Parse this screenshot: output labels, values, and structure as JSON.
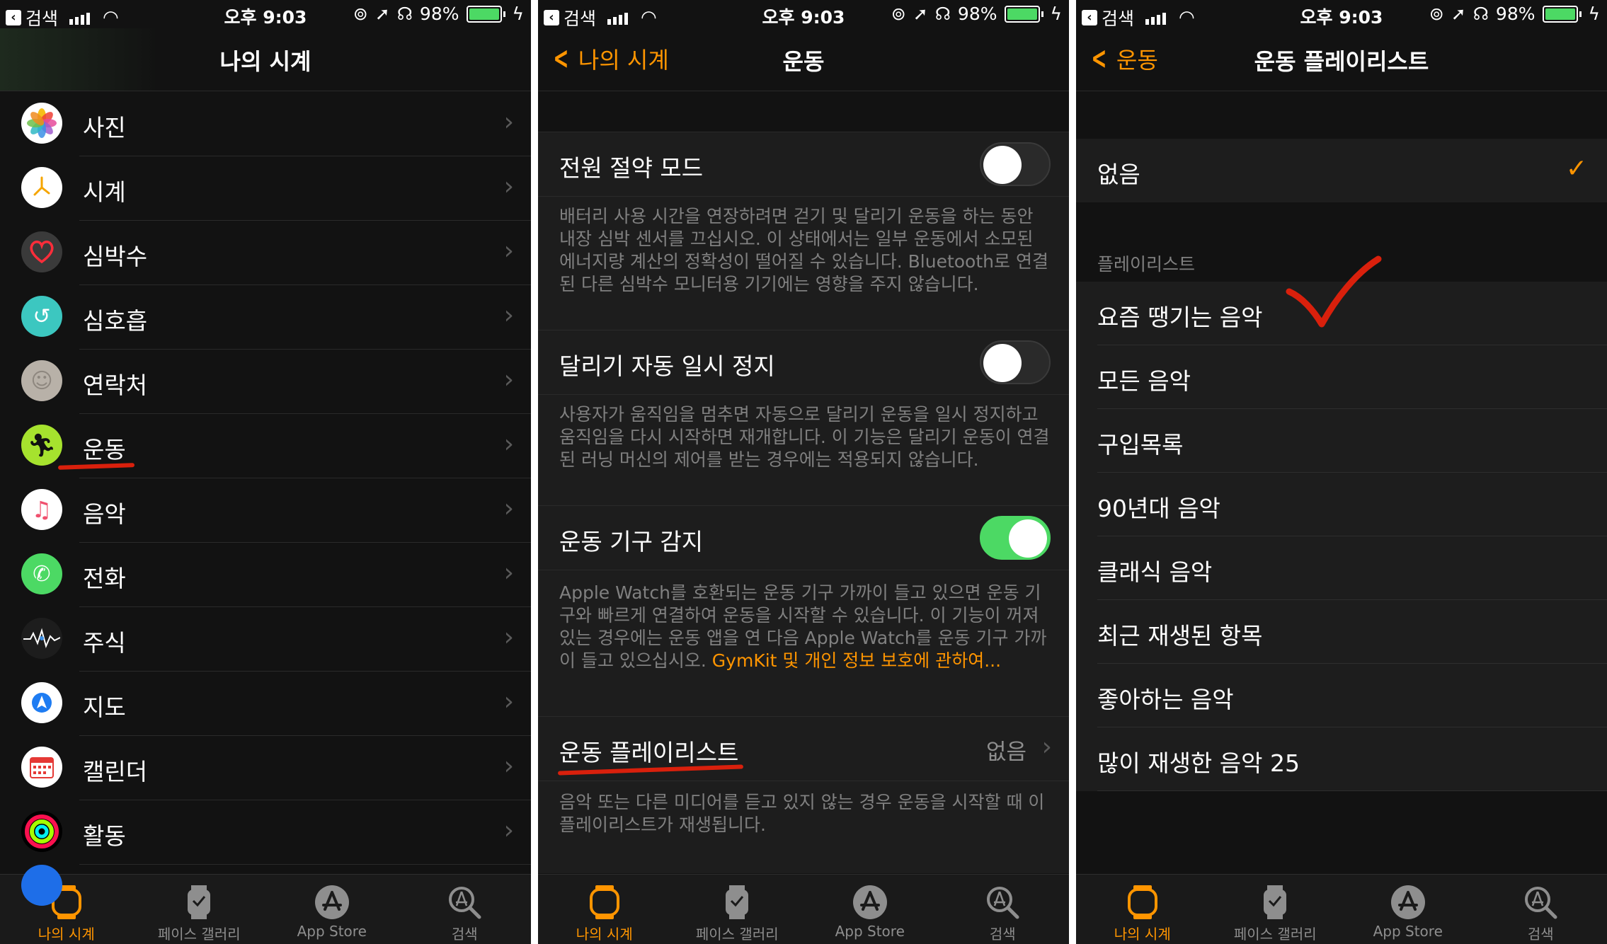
{
  "status": {
    "back_app": "검색",
    "time": "오후 9:03",
    "battery": "98%"
  },
  "colors": {
    "accent": "#ff9500",
    "toggle_on": "#4cd964",
    "annotation_red": "#d9200c"
  },
  "tabbar": {
    "items": [
      "나의 시계",
      "페이스 갤러리",
      "App Store",
      "검색"
    ]
  },
  "panel1": {
    "title": "나의 시계",
    "items": [
      {
        "label": "사진",
        "icon": "photos-icon"
      },
      {
        "label": "시계",
        "icon": "clock-icon"
      },
      {
        "label": "심박수",
        "icon": "heart-rate-icon"
      },
      {
        "label": "심호흡",
        "icon": "breathe-icon"
      },
      {
        "label": "연락처",
        "icon": "contacts-icon"
      },
      {
        "label": "운동",
        "icon": "workout-icon"
      },
      {
        "label": "음악",
        "icon": "music-icon"
      },
      {
        "label": "전화",
        "icon": "phone-icon"
      },
      {
        "label": "주식",
        "icon": "stocks-icon"
      },
      {
        "label": "지도",
        "icon": "maps-icon"
      },
      {
        "label": "캘린더",
        "icon": "calendar-icon"
      },
      {
        "label": "활동",
        "icon": "activity-icon"
      }
    ]
  },
  "panel2": {
    "back": "나의 시계",
    "title": "운동",
    "power_saving": {
      "label": "전원 절약 모드",
      "on": false
    },
    "power_saving_desc": "배터리 사용 시간을 연장하려면 걷기 및 달리기 운동을 하는 동안 내장 심박 센서를 끄십시오. 이 상태에서는 일부 운동에서 소모된 에너지량 계산의 정확성이 떨어질 수 있습니다. Bluetooth로 연결된 다른 심박수 모니터용 기기에는 영향을 주지 않습니다.",
    "auto_pause": {
      "label": "달리기 자동 일시 정지",
      "on": false
    },
    "auto_pause_desc": "사용자가 움직임을 멈추면 자동으로 달리기 운동을 일시 정지하고 움직임을 다시 시작하면 재개합니다. 이 기능은 달리기 운동이 연결된 러닝 머신의 제어를 받는 경우에는 적용되지 않습니다.",
    "equipment": {
      "label": "운동 기구 감지",
      "on": true
    },
    "equipment_desc": "Apple Watch를 호환되는 운동 기구 가까이 들고 있으면 운동 기구와 빠르게 연결하여 운동을 시작할 수 있습니다. 이 기능이 꺼져 있는 경우에는 운동 앱을 연 다음 Apple Watch를 운동 기구 가까이 들고 있으십시오.",
    "equipment_link": "GymKit 및 개인 정보 보호에 관하여...",
    "playlist": {
      "label": "운동 플레이리스트",
      "value": "없음"
    },
    "playlist_desc": "음악 또는 다른 미디어를 듣고 있지 않는 경우 운동을 시작할 때 이 플레이리스트가 재생됩니다."
  },
  "panel3": {
    "back": "운동",
    "title": "운동 플레이리스트",
    "none": "없음",
    "section": "플레이리스트",
    "playlists": [
      "요즘 땡기는 음악",
      "모든 음악",
      "구입목록",
      "90년대 음악",
      "클래식 음악",
      "최근 재생된 항목",
      "좋아하는 음악",
      "많이 재생한 음악 25"
    ]
  }
}
